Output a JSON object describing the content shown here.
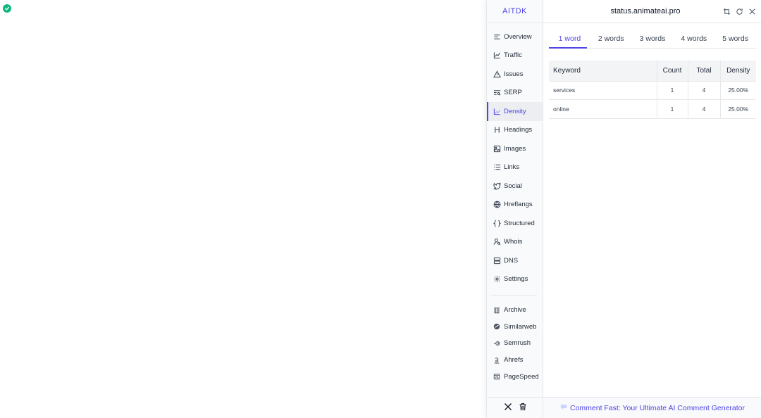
{
  "brand": "AITDK",
  "header": {
    "url": "status.animateai.pro"
  },
  "nav": {
    "items": [
      {
        "label": "Overview",
        "icon": "overview-icon"
      },
      {
        "label": "Traffic",
        "icon": "traffic-icon"
      },
      {
        "label": "Issues",
        "icon": "warning-icon"
      },
      {
        "label": "SERP",
        "icon": "serp-icon"
      },
      {
        "label": "Density",
        "icon": "density-icon",
        "active": true
      },
      {
        "label": "Headings",
        "icon": "heading-icon"
      },
      {
        "label": "Images",
        "icon": "image-icon"
      },
      {
        "label": "Links",
        "icon": "list-icon"
      },
      {
        "label": "Social",
        "icon": "twitter-bird-icon"
      },
      {
        "label": "Hreflangs",
        "icon": "globe-icon"
      },
      {
        "label": "Structured",
        "icon": "braces-icon"
      },
      {
        "label": "Whois",
        "icon": "user-search-icon"
      },
      {
        "label": "DNS",
        "icon": "server-icon"
      },
      {
        "label": "Settings",
        "icon": "gear-icon"
      }
    ],
    "external": [
      {
        "label": "Archive",
        "icon": "archive-icon"
      },
      {
        "label": "Similarweb",
        "icon": "similarweb-icon"
      },
      {
        "label": "Semrush",
        "icon": "semrush-icon"
      },
      {
        "label": "Ahrefs",
        "icon": "ahrefs-icon"
      },
      {
        "label": "PageSpeed",
        "icon": "pagespeed-icon"
      }
    ]
  },
  "tabs": [
    {
      "label": "1 word",
      "active": true
    },
    {
      "label": "2 words"
    },
    {
      "label": "3 words"
    },
    {
      "label": "4 words"
    },
    {
      "label": "5 words"
    }
  ],
  "table": {
    "headers": {
      "keyword": "Keyword",
      "count": "Count",
      "total": "Total",
      "density": "Density"
    },
    "rows": [
      {
        "keyword": "services",
        "count": "1",
        "total": "4",
        "density": "25.00%"
      },
      {
        "keyword": "online",
        "count": "1",
        "total": "4",
        "density": "25.00%"
      }
    ]
  },
  "promo": {
    "text": "Comment Fast: Your Ultimate AI Comment Generator"
  },
  "colors": {
    "accent": "#4f46e5",
    "status_ok": "#10b981"
  }
}
